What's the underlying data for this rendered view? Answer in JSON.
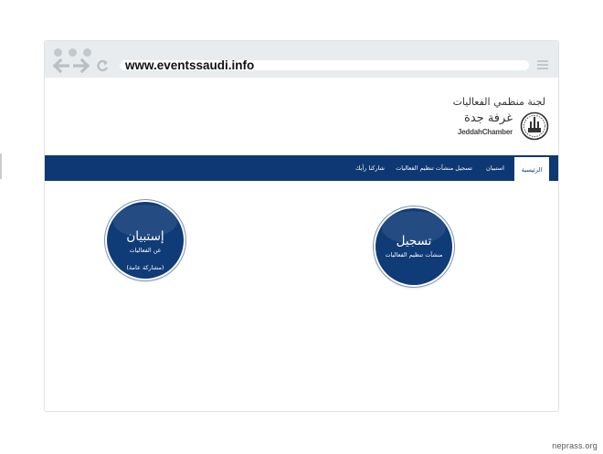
{
  "browser": {
    "url": "www.eventssaudi.info",
    "icons": [
      "back-arrow-icon",
      "forward-arrow-icon",
      "reload-icon",
      "menu-icon"
    ]
  },
  "header": {
    "committee_name": "لجنة منظمي الفعاليات",
    "logo_arabic": "غرفة جدة",
    "logo_english": "JeddahChamber"
  },
  "nav": {
    "items": [
      {
        "label": "الرئيسية",
        "active": true
      },
      {
        "label": "استبيان",
        "active": false
      },
      {
        "label": "تسجيل منشآت تنظيم الفعاليات",
        "active": false
      },
      {
        "label": "شاركنا رأيك",
        "active": false
      }
    ]
  },
  "cards": {
    "survey": {
      "title": "إستبيان",
      "subtitle": "عن الفعاليات",
      "note": "(مشاركة عامة)"
    },
    "register": {
      "title": "تسجيل",
      "subtitle": "منشآت تنظيم الفعاليات"
    }
  },
  "watermark": "neprass.org",
  "colors": {
    "brand_navy": "#0e3873",
    "chrome_gray": "#e9ecee"
  }
}
